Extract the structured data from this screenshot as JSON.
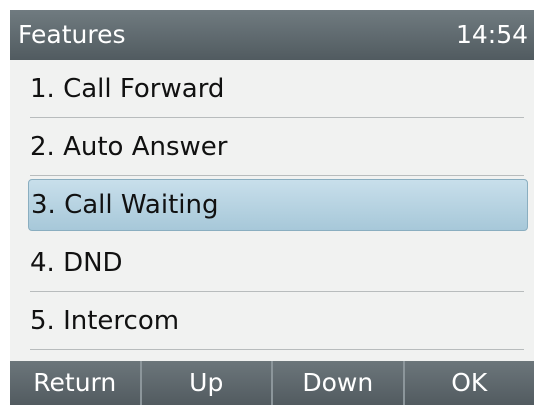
{
  "header": {
    "title": "Features",
    "clock": "14:54"
  },
  "menu": {
    "items": [
      {
        "label": "1. Call Forward",
        "selected": false
      },
      {
        "label": "2. Auto Answer",
        "selected": false
      },
      {
        "label": "3. Call Waiting",
        "selected": true
      },
      {
        "label": "4. DND",
        "selected": false
      },
      {
        "label": "5. Intercom",
        "selected": false
      }
    ]
  },
  "softkeys": {
    "return": "Return",
    "up": "Up",
    "down": "Down",
    "ok": "OK"
  },
  "colors": {
    "header_bg": "#5f6a6f",
    "selection_bg": "#b7d4e4",
    "softkey_bg": "#5b6469"
  }
}
